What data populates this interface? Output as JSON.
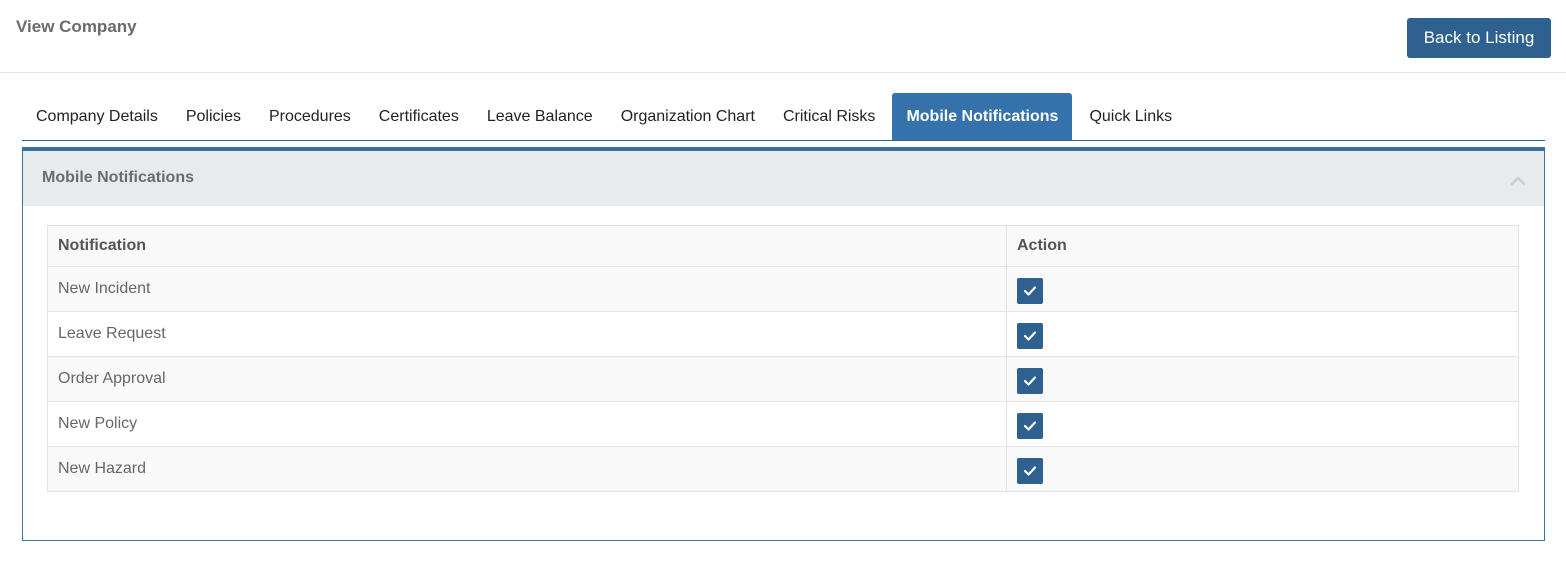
{
  "header": {
    "title": "View Company",
    "back_label": "Back to Listing"
  },
  "tabs": [
    {
      "label": "Company Details",
      "active": false
    },
    {
      "label": "Policies",
      "active": false
    },
    {
      "label": "Procedures",
      "active": false
    },
    {
      "label": "Certificates",
      "active": false
    },
    {
      "label": "Leave Balance",
      "active": false
    },
    {
      "label": "Organization Chart",
      "active": false
    },
    {
      "label": "Critical Risks",
      "active": false
    },
    {
      "label": "Mobile Notifications",
      "active": true
    },
    {
      "label": "Quick Links",
      "active": false
    }
  ],
  "panel": {
    "title": "Mobile Notifications",
    "collapse_icon": "chevron-up-icon"
  },
  "table": {
    "columns": [
      "Notification",
      "Action"
    ],
    "rows": [
      {
        "notification": "New Incident",
        "checked": true
      },
      {
        "notification": "Leave Request",
        "checked": true
      },
      {
        "notification": "Order Approval",
        "checked": true
      },
      {
        "notification": "New Policy",
        "checked": true
      },
      {
        "notification": "New Hazard",
        "checked": true
      }
    ]
  },
  "colors": {
    "primary": "#2e6190",
    "active_tab": "#3572ac",
    "panel_header_bg": "#e8ebee"
  }
}
